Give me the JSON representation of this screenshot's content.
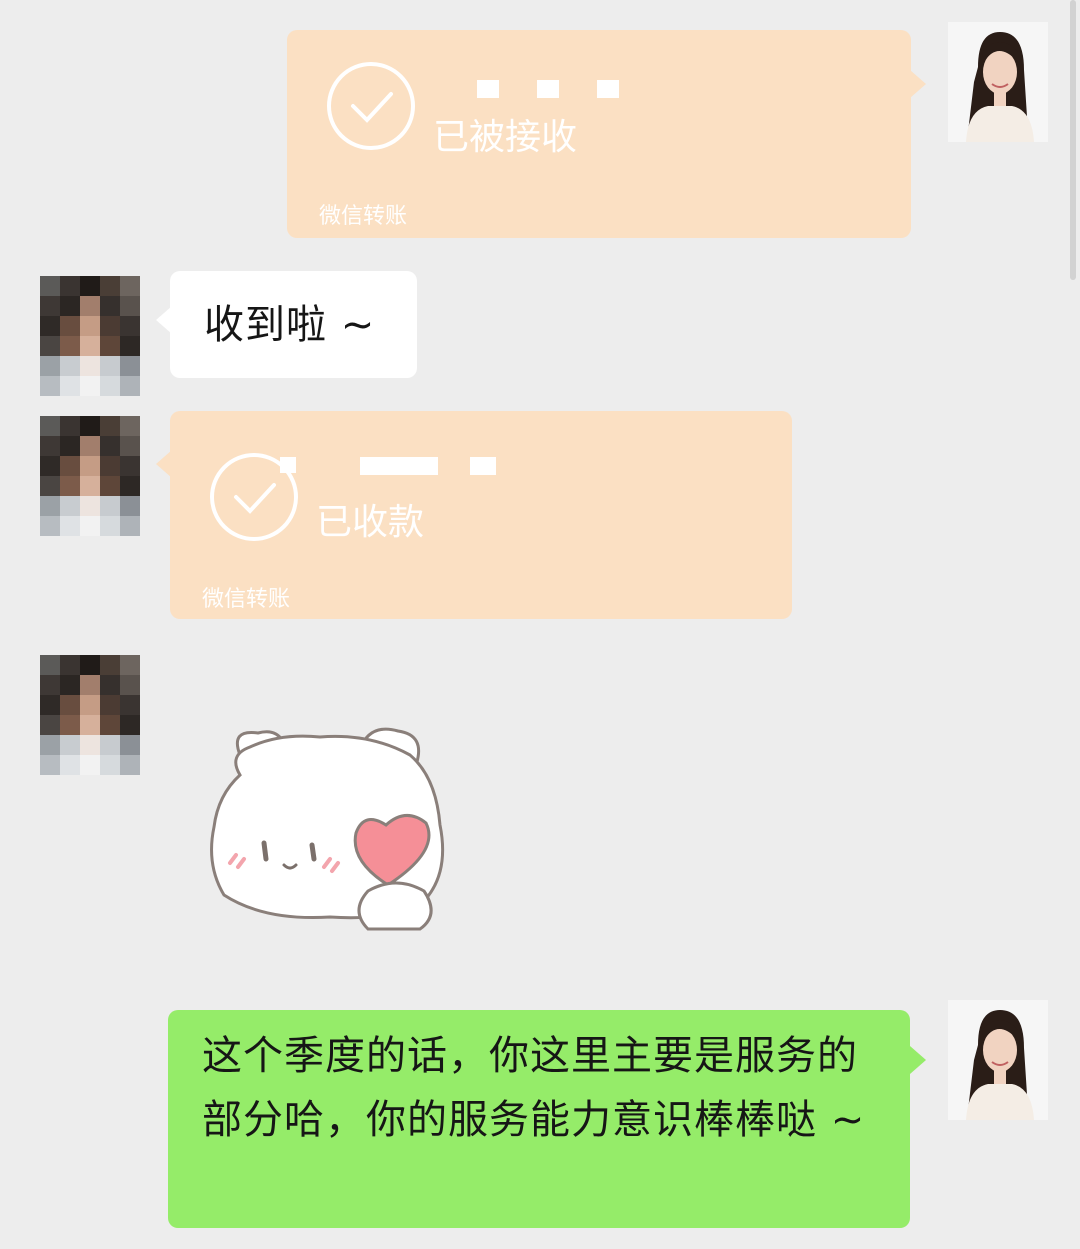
{
  "chat": {
    "messages": [
      {
        "side": "right",
        "type": "transfer",
        "status": "已被接收",
        "footer": "微信转账"
      },
      {
        "side": "left",
        "type": "text",
        "text": "收到啦 ~"
      },
      {
        "side": "left",
        "type": "transfer",
        "status": "已收款",
        "footer": "微信转账"
      },
      {
        "side": "left",
        "type": "sticker",
        "sticker": "bear-holding-heart"
      },
      {
        "side": "right",
        "type": "text",
        "text": "这个季度的话，你这里主要是服务的部分哈，你的服务能力意识棒棒哒 ~"
      }
    ]
  },
  "icons": {
    "check": "check-circle-icon"
  },
  "colors": {
    "background": "#ededed",
    "transfer_bubble": "#fbe0c3",
    "outgoing_bubble": "#95ec69",
    "incoming_bubble": "#ffffff",
    "heart": "#f58f97"
  }
}
